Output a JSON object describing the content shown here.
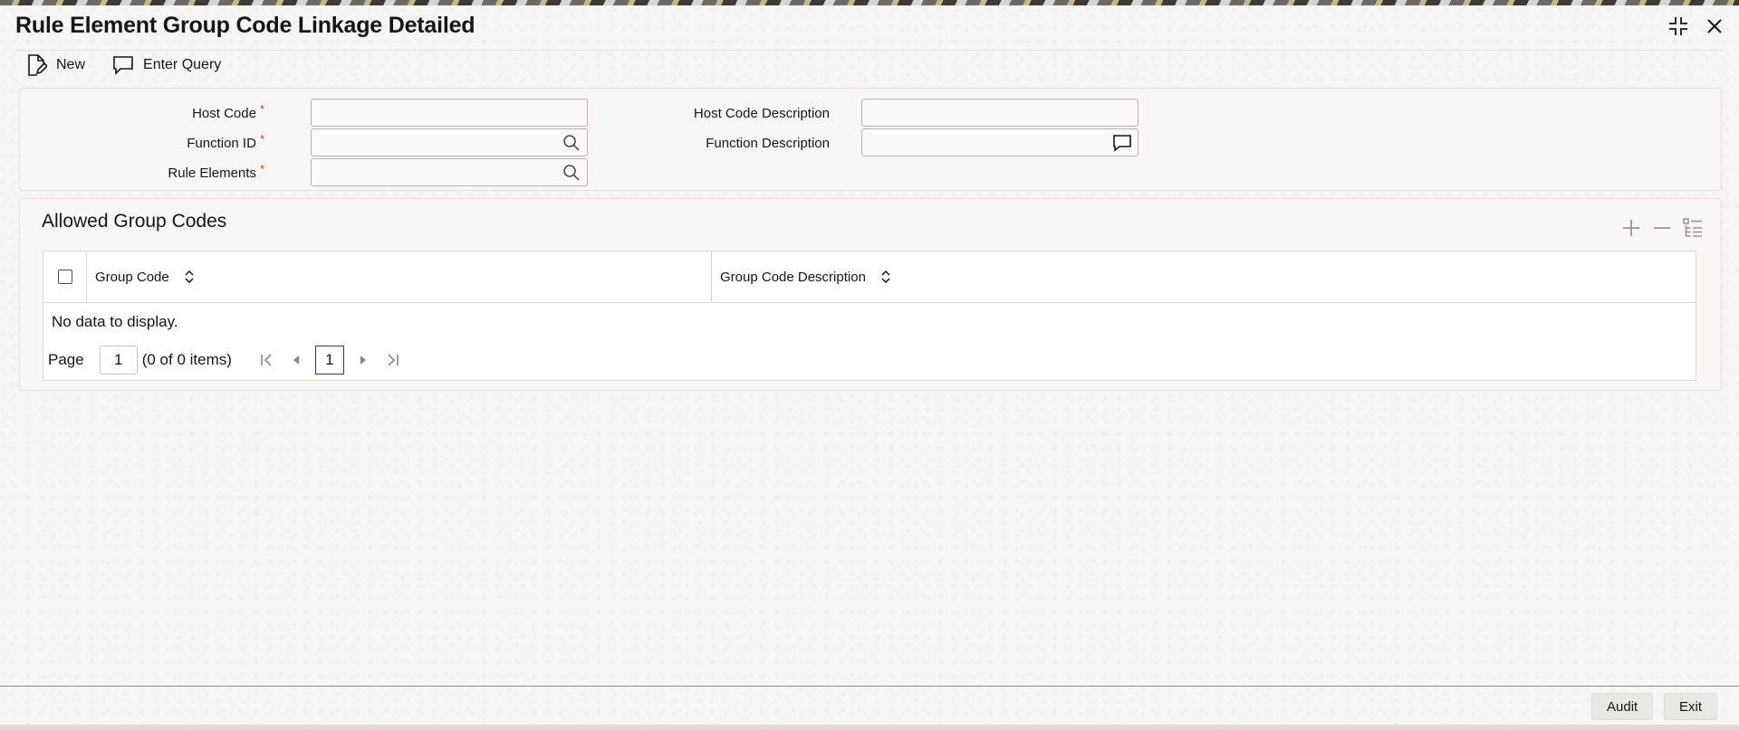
{
  "window": {
    "title": "Rule Element Group Code Linkage Detailed",
    "controls": [
      "collapse-icon",
      "close-icon"
    ]
  },
  "toolbar": {
    "new_label": "New",
    "enter_query_label": "Enter Query"
  },
  "form": {
    "host_code": {
      "label": "Host Code",
      "required": "*",
      "value": ""
    },
    "function_id": {
      "label": "Function ID",
      "required": "*",
      "value": ""
    },
    "rule_elements": {
      "label": "Rule Elements",
      "required": "*",
      "value": ""
    },
    "host_code_description": {
      "label": "Host Code Description",
      "value": ""
    },
    "function_description": {
      "label": "Function Description",
      "value": ""
    }
  },
  "grid": {
    "title": "Allowed Group Codes",
    "columns": [
      "Group Code",
      "Group Code Description"
    ],
    "rows": [],
    "empty_text": "No data to display.",
    "pager": {
      "page_label": "Page",
      "page_value": "1",
      "items_text": "(0 of 0 items)",
      "current_page": "1"
    }
  },
  "footer": {
    "audit_label": "Audit",
    "exit_label": "Exit"
  },
  "colors": {
    "required": "#c74634",
    "text": "#161513",
    "border": "#dcd8d2"
  }
}
